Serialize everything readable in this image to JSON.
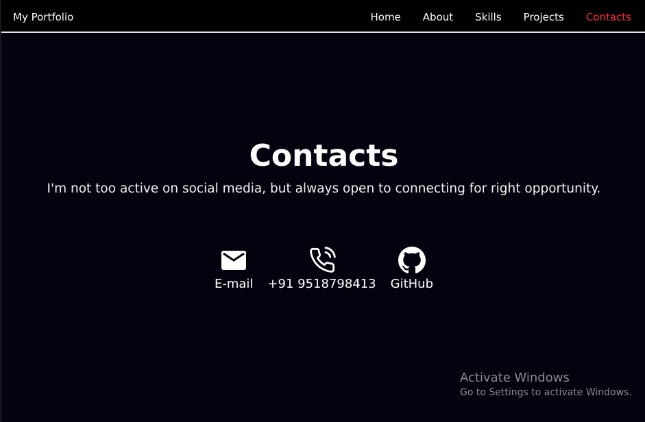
{
  "navbar": {
    "brand": "My Portfolio",
    "items": [
      {
        "label": "Home",
        "active": false
      },
      {
        "label": "About",
        "active": false
      },
      {
        "label": "Skills",
        "active": false
      },
      {
        "label": "Projects",
        "active": false
      },
      {
        "label": "Contacts",
        "active": true
      }
    ]
  },
  "main": {
    "title": "Contacts",
    "subtitle": "I'm not too active on social media, but always open to connecting for right opportunity.",
    "contacts": [
      {
        "icon": "mail-icon",
        "label": "E-mail"
      },
      {
        "icon": "phone-icon",
        "label": "+91 9518798413"
      },
      {
        "icon": "github-icon",
        "label": "GitHub"
      }
    ]
  },
  "watermark": {
    "title": "Activate Windows",
    "subtitle": "Go to Settings to activate Windows."
  },
  "colors": {
    "background": "#03030f",
    "navbar": "#000000",
    "active_link": "#ff2d3a",
    "text": "#ffffff"
  }
}
